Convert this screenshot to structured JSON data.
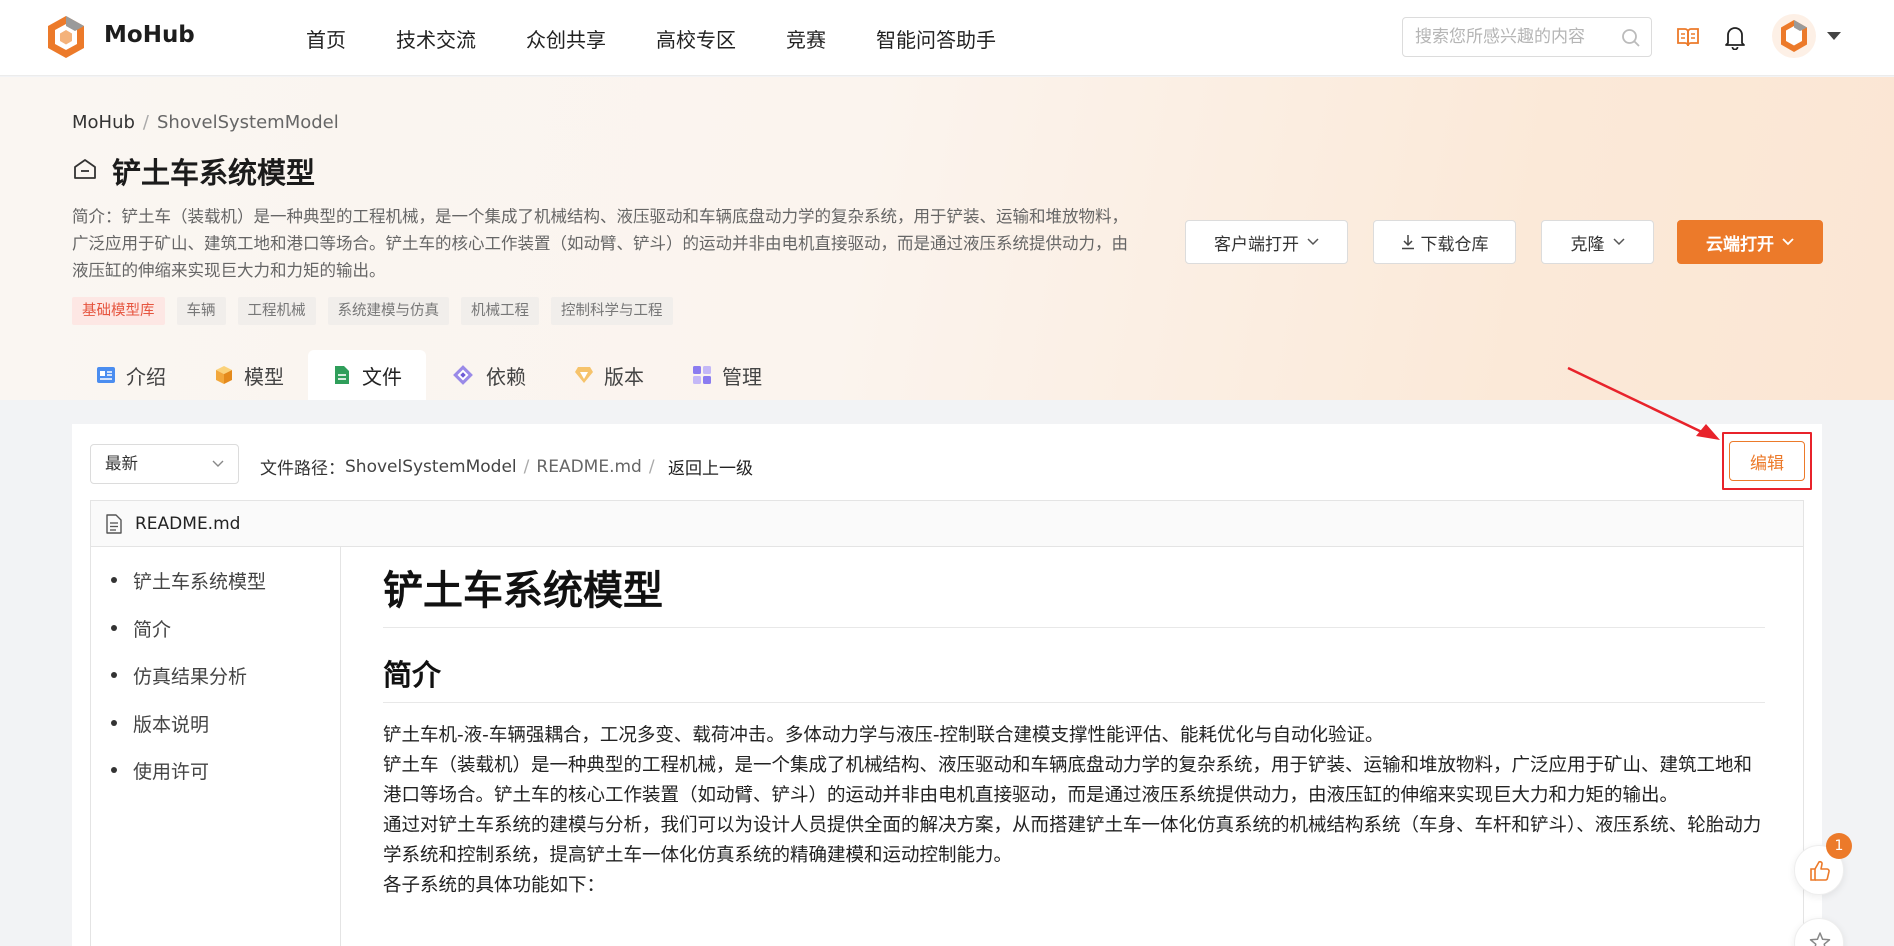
{
  "nav": {
    "brand": "MoHub",
    "links": [
      "首页",
      "技术交流",
      "众创共享",
      "高校专区",
      "竞赛",
      "智能问答助手"
    ],
    "search_placeholder": "搜索您所感兴趣的内容"
  },
  "breadcrumb": {
    "root": "MoHub",
    "current": "ShovelSystemModel",
    "separator": "/"
  },
  "repo": {
    "title": "铲土车系统模型",
    "description": "简介：铲土车（装载机）是一种典型的工程机械，是一个集成了机械结构、液压驱动和车辆底盘动力学的复杂系统，用于铲装、运输和堆放物料，广泛应用于矿山、建筑工地和港口等场合。铲土车的核心工作装置（如动臂、铲斗）的运动并非由电机直接驱动，而是通过液压系统提供动力，由液压缸的伸缩来实现巨大力和力矩的输出。",
    "tags": [
      "基础模型库",
      "车辆",
      "工程机械",
      "系统建模与仿真",
      "机械工程",
      "控制科学与工程"
    ]
  },
  "actions": {
    "client_open": "客户端打开",
    "download": "下载仓库",
    "clone": "克隆",
    "cloud_open": "云端打开"
  },
  "tabs": [
    {
      "label": "介绍",
      "icon": "intro-icon"
    },
    {
      "label": "模型",
      "icon": "cube-icon"
    },
    {
      "label": "文件",
      "icon": "file-icon",
      "active": true
    },
    {
      "label": "依赖",
      "icon": "dependency-icon"
    },
    {
      "label": "版本",
      "icon": "diamond-icon"
    },
    {
      "label": "管理",
      "icon": "grid-icon"
    }
  ],
  "files": {
    "version": "最新",
    "path_label": "文件路径：",
    "path": [
      "ShovelSystemModel",
      "README.md"
    ],
    "path_separator": "/",
    "back": "返回上一级",
    "edit": "编辑",
    "filename": "README.md"
  },
  "toc": [
    "铲土车系统模型",
    "简介",
    "仿真结果分析",
    "版本说明",
    "使用许可"
  ],
  "readme": {
    "h1": "铲土车系统模型",
    "h2": "简介",
    "paragraphs": [
      "铲土车机-液-车辆强耦合，工况多变、载荷冲击。多体动力学与液压-控制联合建模支撑性能评估、能耗优化与自动化验证。",
      "铲土车（装载机）是一种典型的工程机械，是一个集成了机械结构、液压驱动和车辆底盘动力学的复杂系统，用于铲装、运输和堆放物料，广泛应用于矿山、建筑工地和港口等场合。铲土车的核心工作装置（如动臂、铲斗）的运动并非由电机直接驱动，而是通过液压系统提供动力，由液压缸的伸缩来实现巨大力和力矩的输出。",
      "通过对铲土车系统的建模与分析，我们可以为设计人员提供全面的解决方案，从而搭建铲土车一体化仿真系统的机械结构系统（车身、车杆和铲斗）、液压系统、轮胎动力学系统和控制系统，提高铲土车一体化仿真系统的精确建模和运动控制能力。",
      "各子系统的具体功能如下："
    ]
  },
  "floating": {
    "like_count": "1"
  },
  "colors": {
    "accent": "#ec7a2a",
    "highlight": "#e8232b"
  }
}
